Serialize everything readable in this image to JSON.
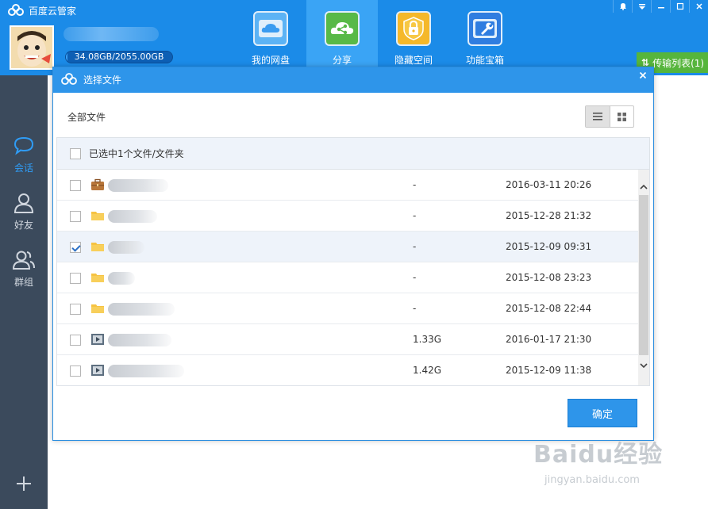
{
  "app": {
    "title": "百度云管家"
  },
  "user": {
    "quota_text": "34.08GB/2055.00GB",
    "quota_used_fraction": 0.0166
  },
  "nav": [
    {
      "label": "我的网盘",
      "icon": "cloud-icon",
      "active": false
    },
    {
      "label": "分享",
      "icon": "share-icon",
      "active": true
    },
    {
      "label": "隐藏空间",
      "icon": "lock-icon",
      "active": false
    },
    {
      "label": "功能宝箱",
      "icon": "wrench-icon",
      "active": false
    }
  ],
  "window_controls": [
    "bell-icon",
    "menu-icon",
    "minimize-icon",
    "maximize-icon",
    "close-icon"
  ],
  "transfer": {
    "label": "传输列表(1)"
  },
  "sidebar": [
    {
      "label": "会话",
      "icon": "chat-icon",
      "active": true
    },
    {
      "label": "好友",
      "icon": "friend-icon",
      "active": false
    },
    {
      "label": "群组",
      "icon": "group-icon",
      "active": false
    }
  ],
  "dialog": {
    "title": "选择文件",
    "breadcrumb": "全部文件",
    "selection_text": "已选中1个文件/文件夹",
    "confirm_label": "确定",
    "rows": [
      {
        "type": "briefcase",
        "size": "-",
        "date": "2016-03-11 20:26",
        "checked": false
      },
      {
        "type": "folder",
        "size": "-",
        "date": "2015-12-28 21:32",
        "checked": false
      },
      {
        "type": "folder",
        "size": "-",
        "date": "2015-12-09 09:31",
        "checked": true
      },
      {
        "type": "folder",
        "size": "-",
        "date": "2015-12-08 23:23",
        "checked": false
      },
      {
        "type": "folder",
        "size": "-",
        "date": "2015-12-08 22:44",
        "checked": false
      },
      {
        "type": "video",
        "size": "1.33G",
        "date": "2016-01-17 21:30",
        "checked": false
      },
      {
        "type": "video",
        "size": "1.42G",
        "date": "2015-12-09 11:38",
        "checked": false
      }
    ]
  },
  "watermark": {
    "logo": "Baidu经验",
    "url": "jingyan.baidu.com"
  },
  "colors": {
    "primary": "#1b8be8",
    "accent": "#2e95ea",
    "sidebar": "#3b4a5c",
    "transfer": "#56b53c",
    "folder": "#f6c342"
  }
}
